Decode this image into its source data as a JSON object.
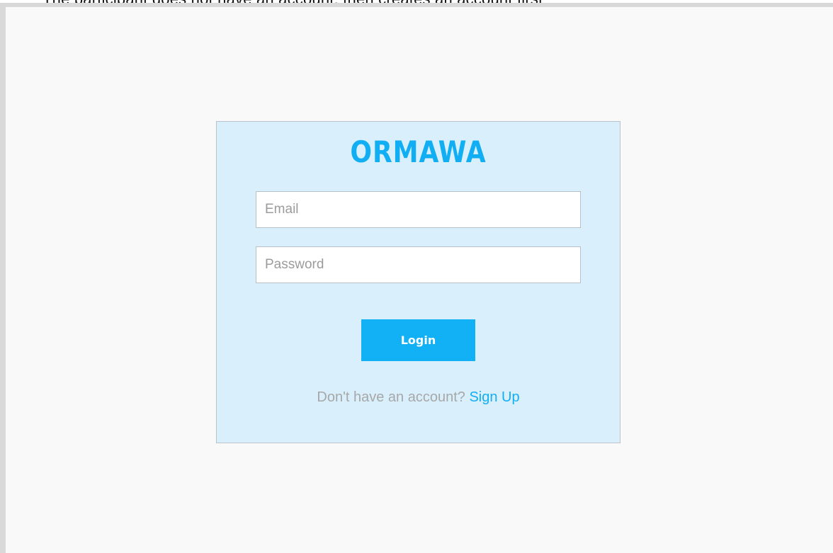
{
  "caption": {
    "text": "The participant does not have an account, then creates an account first"
  },
  "login_card": {
    "brand": "ORMAWA",
    "email_placeholder": "Email",
    "password_placeholder": "Password",
    "login_label": "Login",
    "signup_prompt": "Don't have an account?",
    "signup_link": "Sign Up"
  },
  "colors": {
    "accent": "#12aef4",
    "card_background": "#d9f0fc",
    "page_background": "#f9f9f9"
  }
}
